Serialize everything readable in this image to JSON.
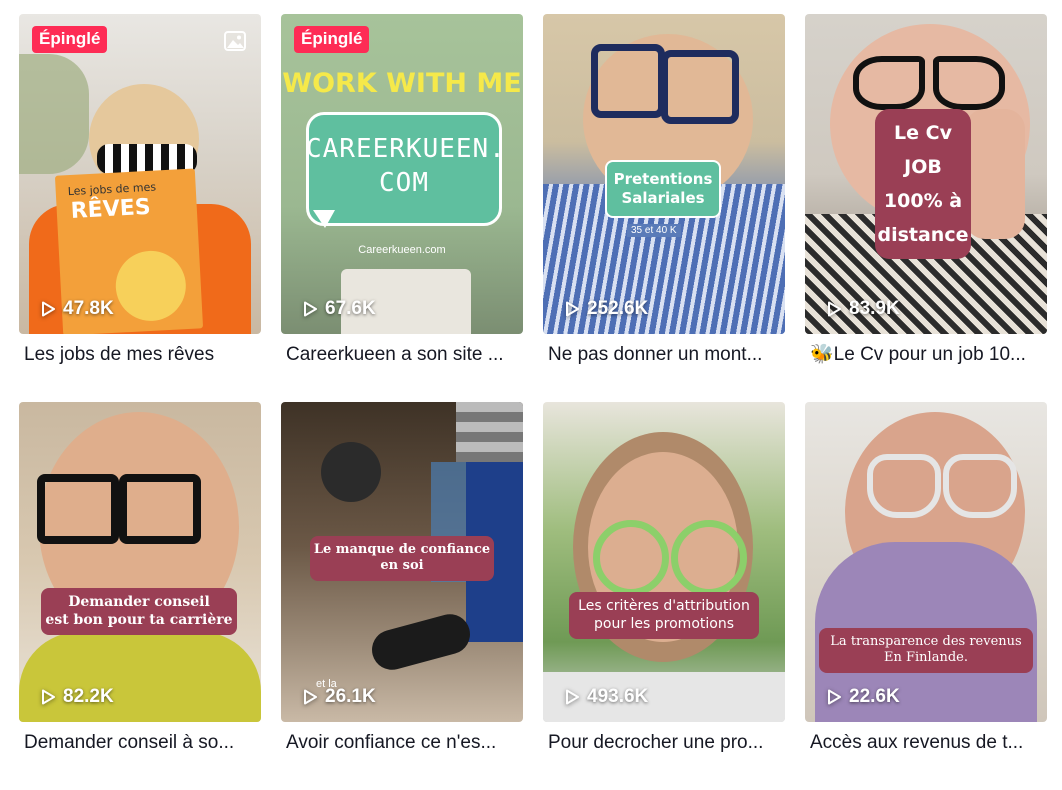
{
  "videos": [
    {
      "views": "47.8K",
      "caption": "Les jobs de mes rêves",
      "badge": "Épinglé",
      "book_text": [
        "Les jobs de mes",
        "RÊVES"
      ]
    },
    {
      "views": "67.6K",
      "caption": "Careerkueen a son site ...",
      "badge": "Épinglé",
      "overlay_title": "WORK WITH ME",
      "overlay_bubble": [
        "CAREERKUEEN.",
        "COM"
      ],
      "overlay_small": "Careerkueen.com"
    },
    {
      "views": "252.6K",
      "caption": "Ne pas donner un mont...",
      "overlay": [
        "Pretentions",
        "Salariales"
      ],
      "overlay_small": "35 et 40 K"
    },
    {
      "views": "83.9K",
      "caption": "🐝Le Cv pour un job 10...",
      "overlay": [
        "Le Cv",
        "JOB",
        "100% à",
        "distance"
      ]
    },
    {
      "views": "82.2K",
      "caption": "Demander conseil à so...",
      "overlay": [
        "Demander conseil",
        "est bon pour ta carrière"
      ]
    },
    {
      "views": "26.1K",
      "caption": "Avoir confiance ce n'es...",
      "overlay": [
        "Le manque de confiance",
        "en soi"
      ],
      "overlay_small": "et la"
    },
    {
      "views": "493.6K",
      "caption": "Pour decrocher une pro...",
      "overlay": [
        "Les critères d'attribution",
        "pour les promotions"
      ]
    },
    {
      "views": "22.6K",
      "caption": "Accès aux revenus de t...",
      "overlay": [
        "La transparence des revenus",
        "En Finlande."
      ]
    }
  ],
  "colors": {
    "pinned_badge": "#fe2c55",
    "overlay_maroon": "#9a3f55",
    "bubble_teal": "#5fbf9f",
    "caption_text": "#161823"
  },
  "icons": {
    "play": "play-icon",
    "photo": "photo-icon"
  }
}
